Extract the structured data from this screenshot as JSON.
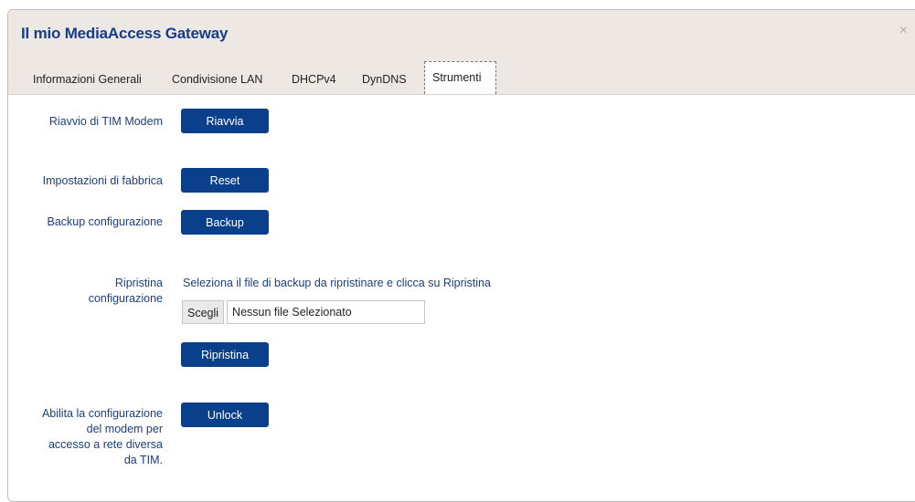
{
  "modal": {
    "title": "Il mio MediaAccess Gateway",
    "close_label": "×"
  },
  "tabs": [
    {
      "label": "Informazioni Generali",
      "active": false
    },
    {
      "label": "Condivisione LAN",
      "active": false
    },
    {
      "label": "DHCPv4",
      "active": false
    },
    {
      "label": "DynDNS",
      "active": false
    },
    {
      "label": "Strumenti",
      "active": true
    }
  ],
  "tools": {
    "reboot": {
      "label": "Riavvio di TIM Modem",
      "button": "Riavvia"
    },
    "factory": {
      "label": "Impostazioni di fabbrica",
      "button": "Reset"
    },
    "backup": {
      "label": "Backup configurazione",
      "button": "Backup"
    },
    "restore": {
      "label_line1": "Ripristina",
      "label_line2": "configurazione",
      "help": "Seleziona il file di backup da ripristinare e clicca su Ripristina",
      "choose_button": "Scegli",
      "file_name": "Nessun file Selezionato",
      "button": "Ripristina"
    },
    "unlock": {
      "label_line1": "Abilita la configurazione",
      "label_line2": "del modem per",
      "label_line3": "accesso a rete diversa",
      "label_line4": "da TIM.",
      "button": "Unlock"
    }
  },
  "colors": {
    "header_bg": "#ede8e4",
    "title": "#163d8a",
    "button_bg": "#0a3f8c",
    "label_text": "#1c3f7e"
  }
}
